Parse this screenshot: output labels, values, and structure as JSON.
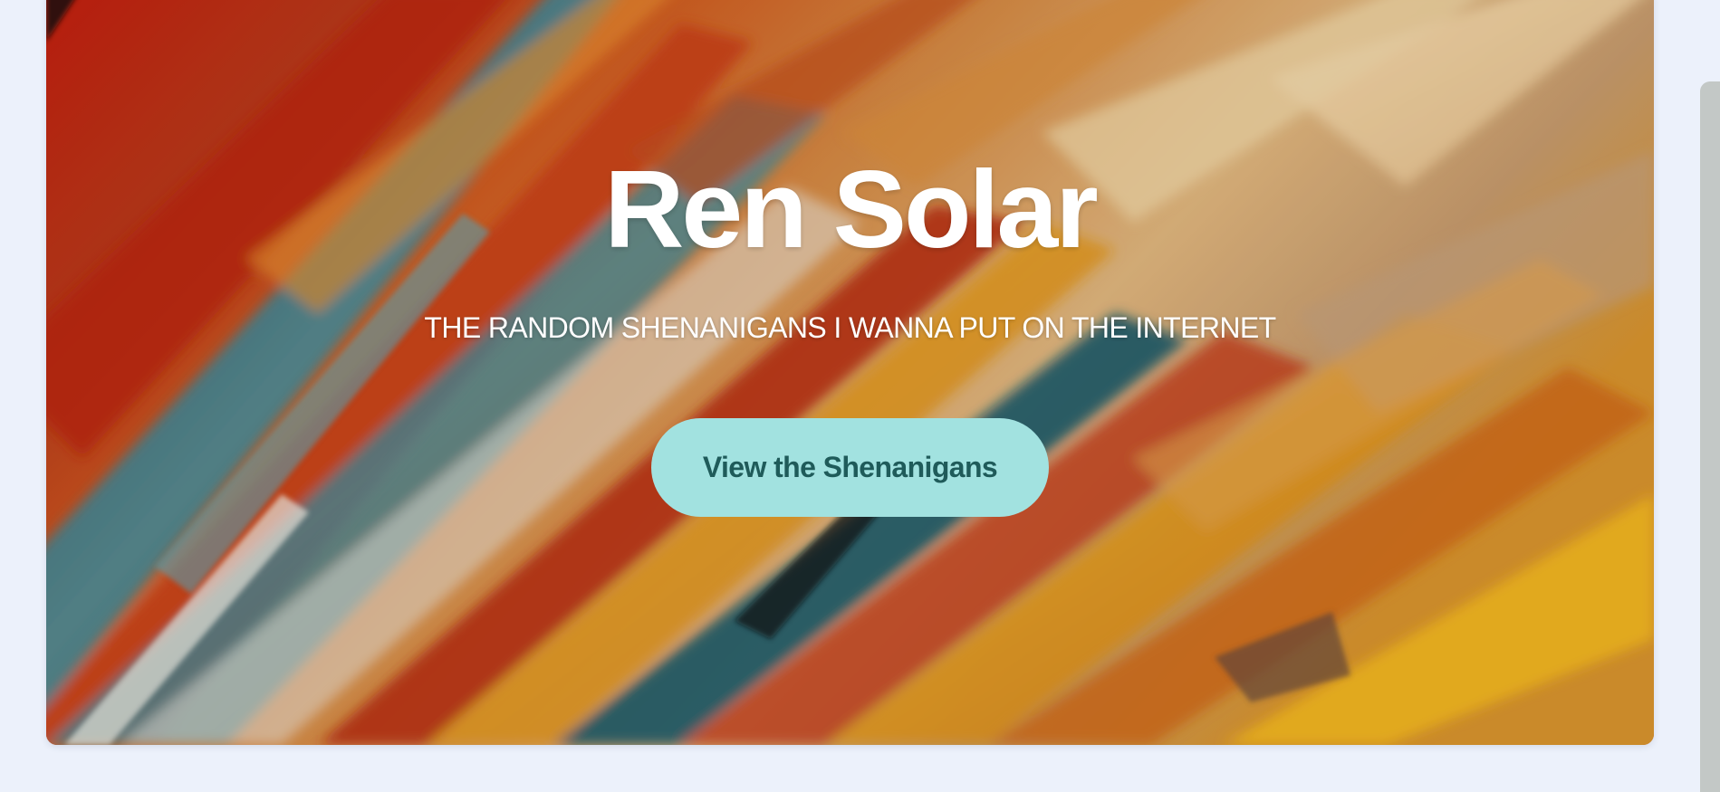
{
  "hero": {
    "title": "Ren Solar",
    "subtitle": "THE RANDOM SHENANIGANS I WANNA PUT ON THE INTERNET",
    "cta_label": "View the Shenanigans",
    "background": "abstract swirling paint artwork",
    "cta_color": "#a2e2e0",
    "cta_text_color": "#1f5b5a",
    "title_color": "#ffffff"
  },
  "page": {
    "background_color": "#ecf1fb"
  }
}
